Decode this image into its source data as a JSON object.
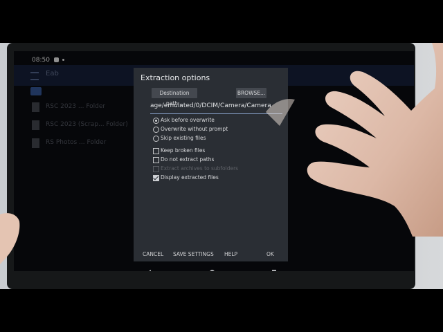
{
  "status": {
    "time": "08:50"
  },
  "app": {
    "title": "Eab"
  },
  "files": [
    {
      "name": "RSC 2023 ... Folder"
    },
    {
      "name": "RSC 2023 (Scrap... Folder)"
    },
    {
      "name": "RS Photos ... Folder"
    }
  ],
  "dialog": {
    "title": "Extraction options",
    "destination_label": "Destination path...",
    "browse_label": "BROWSE...",
    "path_value": "age/emulated/0/DCIM/Camera/Camera",
    "options": {
      "ask_before_overwrite": "Ask before overwrite",
      "overwrite_without_prompt": "Overwrite without prompt",
      "skip_existing": "Skip existing files",
      "keep_broken": "Keep broken files",
      "do_not_extract_paths": "Do not extract paths",
      "extract_to_subfolders": "Extract archives to subfolders",
      "display_extracted": "Display extracted files"
    },
    "selected_overwrite_mode": "Ask before overwrite",
    "display_extracted_checked": true,
    "actions": {
      "cancel": "CANCEL",
      "save_settings": "SAVE SETTINGS",
      "help": "HELP",
      "ok": "OK"
    }
  },
  "colors": {
    "dialog_bg": "#2a2e34",
    "accent": "#8aa4cc",
    "screen_bg": "#090b0f"
  }
}
